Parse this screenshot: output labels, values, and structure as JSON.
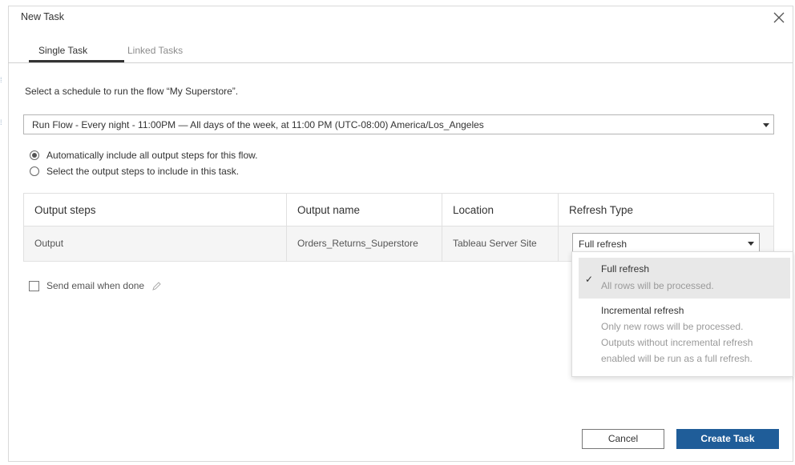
{
  "dialog": {
    "title": "New Task"
  },
  "tabs": [
    {
      "label": "Single Task",
      "active": true
    },
    {
      "label": "Linked Tasks",
      "active": false
    }
  ],
  "prompt": "Select a schedule to run the flow “My Superstore”.",
  "schedule": {
    "selected": "Run Flow - Every night - 11:00PM — All days of the week, at 11:00 PM (UTC-08:00) America/Los_Angeles"
  },
  "radios": [
    {
      "label": "Automatically include all output steps for this flow.",
      "checked": true
    },
    {
      "label": "Select the output steps to include in this task.",
      "checked": false
    }
  ],
  "table": {
    "headers": [
      "Output steps",
      "Output name",
      "Location",
      "Refresh Type"
    ],
    "rows": [
      {
        "output_step": "Output",
        "output_name": "Orders_Returns_Superstore",
        "location": "Tableau Server Site",
        "refresh_type": "Full refresh"
      }
    ]
  },
  "email": {
    "label": "Send email when done",
    "checked": false
  },
  "refresh_dropdown": {
    "options": [
      {
        "label": "Full refresh",
        "desc": "All rows will be processed.",
        "selected": true
      },
      {
        "label": "Incremental refresh",
        "desc_lines": [
          "Only new rows will be processed.",
          "Outputs without incremental refresh",
          "enabled will be run as a full refresh."
        ],
        "selected": false
      }
    ]
  },
  "buttons": {
    "cancel": "Cancel",
    "create": "Create Task"
  },
  "icons": {
    "close": "close-icon",
    "check": "check-icon",
    "pencil": "pencil-icon",
    "caret": "chevron-down-icon"
  },
  "colors": {
    "primary": "#1f5d99",
    "selected_option_bg": "#e8e8e8",
    "row_bg": "#f5f5f5"
  }
}
